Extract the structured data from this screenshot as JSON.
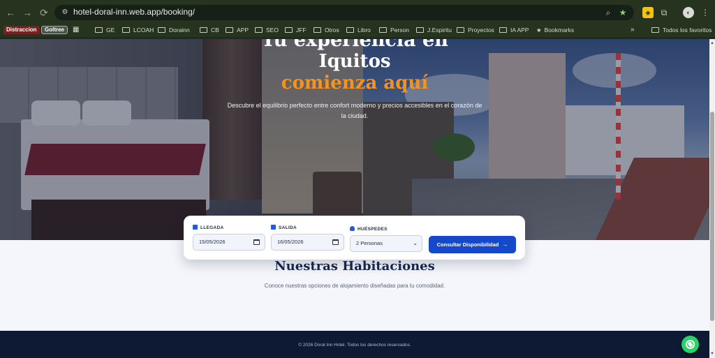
{
  "browser": {
    "url": "hotel-doral-inn.web.app/booking/",
    "nav": {
      "back": "←",
      "forward": "→",
      "reload": "⟳",
      "site_info": "⚙"
    },
    "omnibox_icons": {
      "zoom": "⌕",
      "bookmark_star": "★"
    },
    "toolbar_icons": {
      "extension": "◆",
      "puzzle": "⧉",
      "profile": "◐",
      "menu": "⋮"
    },
    "bookmarks": [
      {
        "label": "Distraccion",
        "style": "chip-red"
      },
      {
        "label": "Goltree",
        "style": "chip-grey"
      },
      {
        "label": "GE",
        "style": "folder"
      },
      {
        "label": "LCOAH",
        "style": "folder"
      },
      {
        "label": "Dorainn",
        "style": "folder"
      },
      {
        "label": "CB",
        "style": "folder"
      },
      {
        "label": "APP",
        "style": "folder"
      },
      {
        "label": "SEO",
        "style": "folder"
      },
      {
        "label": "JFF",
        "style": "folder"
      },
      {
        "label": "Otros",
        "style": "folder"
      },
      {
        "label": "Libro",
        "style": "folder"
      },
      {
        "label": "Person",
        "style": "folder"
      },
      {
        "label": "J.Espiritu",
        "style": "folder"
      },
      {
        "label": "Proyectos",
        "style": "folder"
      },
      {
        "label": "IA APP",
        "style": "folder"
      },
      {
        "label": "Bookmarks",
        "style": "star"
      }
    ],
    "bookmarks_overflow": "»",
    "all_bookmarks": "Todos los favoritos"
  },
  "hero": {
    "line1": "Tu experiencia en",
    "line2": "Iquitos",
    "line3": "comienza aquí",
    "subtitle": "Descubre el equilibrio perfecto entre confort moderno y precios accesibles en el corazón de la ciudad."
  },
  "booking": {
    "arrival_label": "LLEGADA",
    "arrival_value": "15/05/2026",
    "departure_label": "SALIDA",
    "departure_value": "16/05/2026",
    "guests_label": "HUÉSPEDES",
    "guests_value": "2 Personas",
    "cta_label": "Consultar Disponibilidad",
    "cta_arrow": "→"
  },
  "rooms": {
    "title": "Nuestras Habitaciones",
    "subtitle": "Conoce nuestras opciones de alojamiento diseñadas para tu comodidad."
  },
  "footer": {
    "copyright": "© 2026 Doral Inn Hotel. Todos los derechos reservados."
  },
  "colors": {
    "accent_orange": "#f39321",
    "primary_blue": "#1549c9",
    "navy": "#17254a",
    "footer_bg": "#0e1a33",
    "whatsapp_green": "#25d366"
  }
}
